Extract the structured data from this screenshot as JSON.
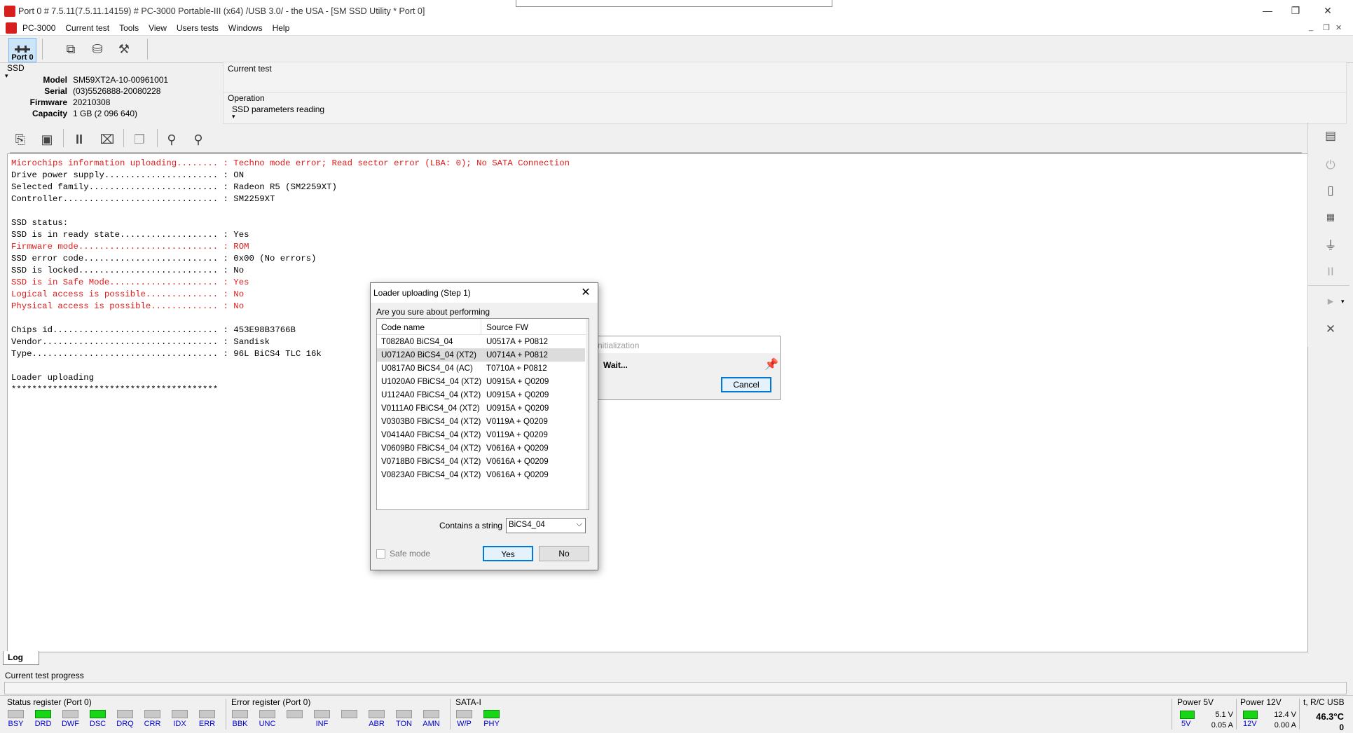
{
  "window": {
    "title": "Port 0 # 7.5.11(7.5.11.14159) # PC-3000 Portable-III (x64) /USB 3.0/ - the USA - [SM SSD Utility * Port 0]",
    "minimize": "—",
    "restore": "❐",
    "close": "✕"
  },
  "menu": {
    "items": [
      "PC-3000",
      "Current test",
      "Tools",
      "View",
      "Users tests",
      "Windows",
      "Help"
    ]
  },
  "toolbar": {
    "port_label": "Port 0"
  },
  "ssd": {
    "header": "SSD",
    "model_label": "Model",
    "model": "SM59XT2A-10-00961001",
    "serial_label": "Serial",
    "serial": "(03)5526888-20080228",
    "firmware_label": "Firmware",
    "firmware": "20210308",
    "capacity_label": "Capacity",
    "capacity": "1 GB (2 096 640)"
  },
  "current_test": {
    "label": "Current test",
    "value": ""
  },
  "operation": {
    "label": "Operation",
    "value": "SSD parameters reading"
  },
  "log": {
    "lines": [
      {
        "text": "Microchips information uploading........ : Techno mode error; Read sector error (LBA: 0); No SATA Connection",
        "red": true
      },
      {
        "text": "Drive power supply...................... : ON",
        "red": false
      },
      {
        "text": "Selected family......................... : Radeon R5 (SM2259XT)",
        "red": false
      },
      {
        "text": "Controller.............................. : SM2259XT",
        "red": false
      },
      {
        "text": "",
        "red": false
      },
      {
        "text": "SSD status:",
        "red": false
      },
      {
        "text": "SSD is in ready state................... : Yes",
        "red": false
      },
      {
        "text": "Firmware mode........................... : ROM",
        "red": true
      },
      {
        "text": "SSD error code.......................... : 0x00 (No errors)",
        "red": false
      },
      {
        "text": "SSD is locked........................... : No",
        "red": false
      },
      {
        "text": "SSD is in Safe Mode..................... : Yes",
        "red": true
      },
      {
        "text": "Logical access is possible.............. : No",
        "red": true
      },
      {
        "text": "Physical access is possible............. : No",
        "red": true
      },
      {
        "text": "",
        "red": false
      },
      {
        "text": "Chips id................................ : 453E98B3766B",
        "red": false
      },
      {
        "text": "Vendor.................................. : Sandisk",
        "red": false
      },
      {
        "text": "Type.................................... : 96L BiCS4 TLC 16k",
        "red": false
      },
      {
        "text": "",
        "red": false
      },
      {
        "text": "Loader uploading",
        "red": false
      },
      {
        "text": "****************************************",
        "red": false
      }
    ],
    "tab_label": "Log"
  },
  "progress": {
    "label": "Current test progress",
    "value_fraction": 0
  },
  "status_register": {
    "title": "Status register (Port 0)",
    "leds": [
      {
        "name": "BSY",
        "on": false
      },
      {
        "name": "DRD",
        "on": true
      },
      {
        "name": "DWF",
        "on": false
      },
      {
        "name": "DSC",
        "on": true
      },
      {
        "name": "DRQ",
        "on": false
      },
      {
        "name": "CRR",
        "on": false
      },
      {
        "name": "IDX",
        "on": false
      },
      {
        "name": "ERR",
        "on": false
      }
    ]
  },
  "error_register": {
    "title": "Error register (Port 0)",
    "leds": [
      {
        "name": "BBK",
        "on": false
      },
      {
        "name": "UNC",
        "on": false
      },
      {
        "name": "",
        "on": false
      },
      {
        "name": "INF",
        "on": false
      },
      {
        "name": "",
        "on": false
      },
      {
        "name": "ABR",
        "on": false
      },
      {
        "name": "TON",
        "on": false
      },
      {
        "name": "AMN",
        "on": false
      }
    ]
  },
  "sata": {
    "title": "SATA-I",
    "leds": [
      {
        "name": "W/P",
        "on": false
      },
      {
        "name": "PHY",
        "on": true
      }
    ]
  },
  "power5v": {
    "title": "Power 5V",
    "led": "5V",
    "voltage": "5.1 V",
    "current": "0.05 A"
  },
  "power12v": {
    "title": "Power 12V",
    "led": "12V",
    "voltage": "12.4 V",
    "current": "0.00 A"
  },
  "temp": {
    "title": "t, R/C USB",
    "value": "46.3°C",
    "count": "0"
  },
  "dialog": {
    "title": "Loader uploading (Step 1)",
    "prompt": "Are you sure about performing",
    "col_code": "Code name",
    "col_fw": "Source FW",
    "rows": [
      {
        "code": "T0828A0 BiCS4_04",
        "fw": "U0517A + P0812",
        "selected": false
      },
      {
        "code": "U0712A0 BiCS4_04 (XT2)",
        "fw": "U0714A + P0812",
        "selected": true
      },
      {
        "code": "U0817A0 BiCS4_04 (AC)",
        "fw": "T0710A + P0812",
        "selected": false
      },
      {
        "code": "U1020A0 FBiCS4_04 (XT2)",
        "fw": "U0915A + Q0209",
        "selected": false
      },
      {
        "code": "U1124A0 FBiCS4_04 (XT2)",
        "fw": "U0915A + Q0209",
        "selected": false
      },
      {
        "code": "V0111A0 FBiCS4_04 (XT2)",
        "fw": "U0915A + Q0209",
        "selected": false
      },
      {
        "code": "V0303B0 FBiCS4_04 (XT2)",
        "fw": "V0119A + Q0209",
        "selected": false
      },
      {
        "code": "V0414A0 FBiCS4_04 (XT2)",
        "fw": "V0119A + Q0209",
        "selected": false
      },
      {
        "code": "V0609B0 FBiCS4_04 (XT2)",
        "fw": "V0616A + Q0209",
        "selected": false
      },
      {
        "code": "V0718B0 FBiCS4_04 (XT2)",
        "fw": "V0616A + Q0209",
        "selected": false
      },
      {
        "code": "V0823A0 FBiCS4_04 (XT2)",
        "fw": "V0616A + Q0209",
        "selected": false
      }
    ],
    "contains_label": "Contains a string",
    "contains_value": "BiCS4_04",
    "safe_mode_label": "Safe mode",
    "yes_label": "Yes",
    "no_label": "No"
  },
  "wait_dialog": {
    "title": "nitialization",
    "message": "Wait...",
    "cancel_label": "Cancel"
  }
}
